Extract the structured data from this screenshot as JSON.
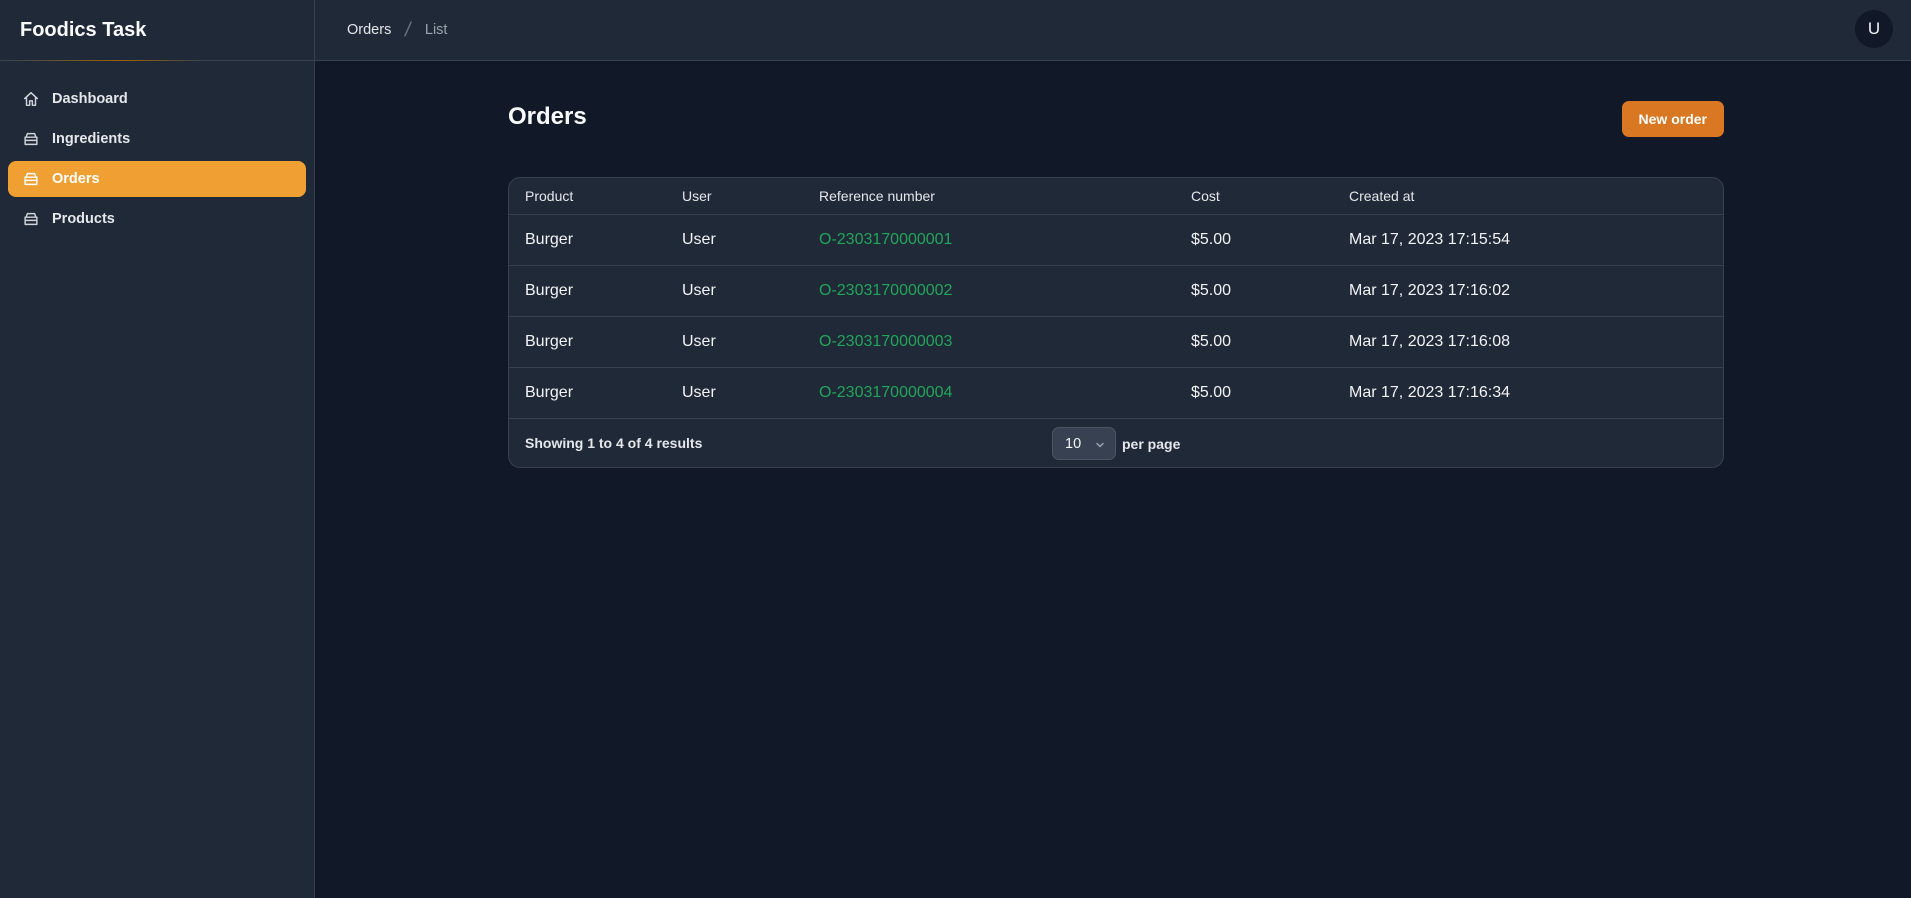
{
  "app": {
    "title": "Foodics Task"
  },
  "sidebar": {
    "items": [
      {
        "label": "Dashboard",
        "icon": "home-icon"
      },
      {
        "label": "Ingredients",
        "icon": "box-icon"
      },
      {
        "label": "Orders",
        "icon": "box-icon",
        "active": true
      },
      {
        "label": "Products",
        "icon": "box-icon"
      }
    ]
  },
  "breadcrumb": {
    "first": "Orders",
    "second": "List"
  },
  "user": {
    "avatar_initial": "U"
  },
  "page": {
    "title": "Orders",
    "new_button": "New order"
  },
  "table": {
    "headers": [
      "Product",
      "User",
      "Reference number",
      "Cost",
      "Created at"
    ],
    "rows": [
      [
        "Burger",
        "User",
        "O-2303170000001",
        "$5.00",
        "Mar 17, 2023 17:15:54"
      ],
      [
        "Burger",
        "User",
        "O-2303170000002",
        "$5.00",
        "Mar 17, 2023 17:16:02"
      ],
      [
        "Burger",
        "User",
        "O-2303170000003",
        "$5.00",
        "Mar 17, 2023 17:16:08"
      ],
      [
        "Burger",
        "User",
        "O-2303170000004",
        "$5.00",
        "Mar 17, 2023 17:16:34"
      ]
    ]
  },
  "pagination": {
    "summary": "Showing 1 to 4 of 4 results",
    "per_page_value": "10",
    "per_page_label": "per page"
  },
  "colors": {
    "accent": "#f0a032",
    "button": "#d97722",
    "link": "#22a55a"
  }
}
